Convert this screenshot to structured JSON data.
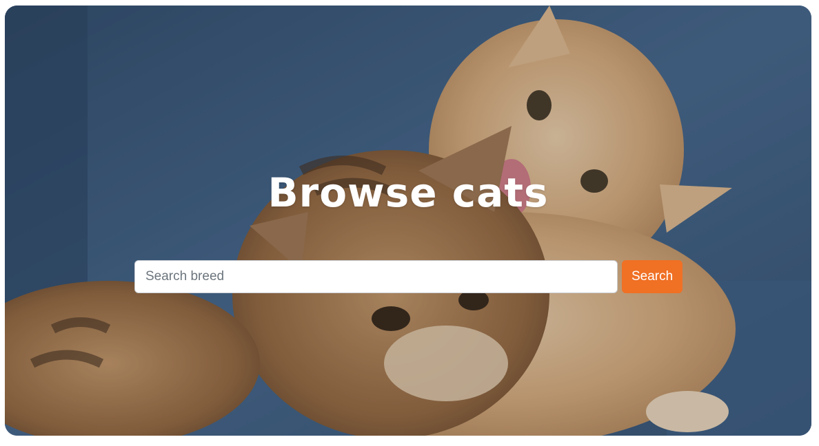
{
  "hero": {
    "title": "Browse cats",
    "image_alt": "Two kittens cuddling on a blue sofa"
  },
  "search": {
    "placeholder": "Search breed",
    "value": "",
    "button_label": "Search"
  },
  "colors": {
    "accent": "#f07024",
    "background_blue": "#3d5878"
  }
}
